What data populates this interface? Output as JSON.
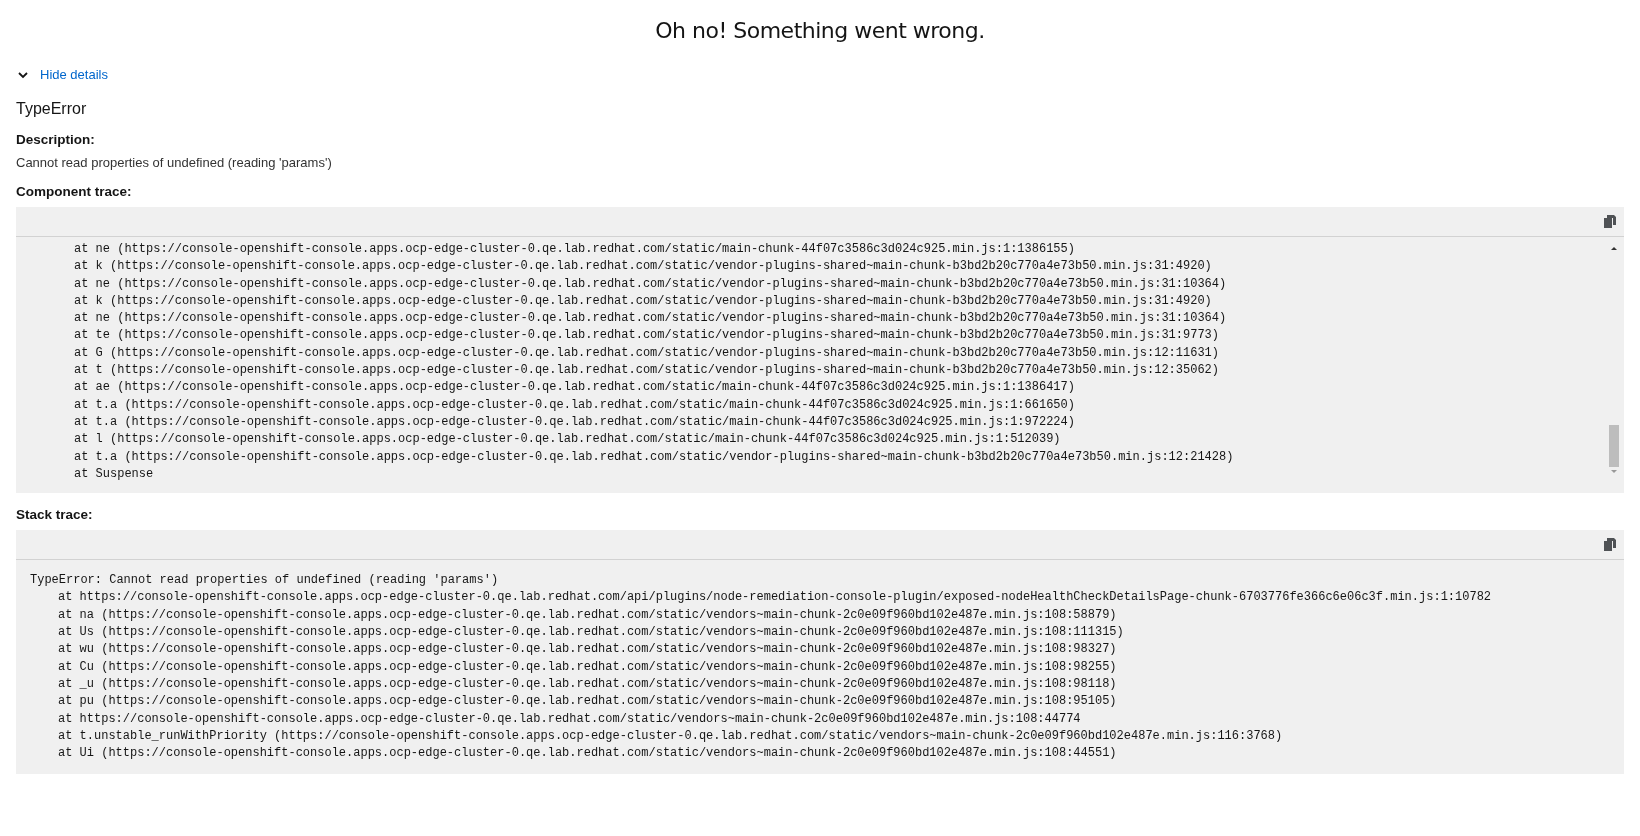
{
  "title": "Oh no! Something went wrong.",
  "details_toggle": {
    "label": "Hide details",
    "expanded": true
  },
  "error_name": "TypeError",
  "description": {
    "label": "Description:",
    "text": "Cannot read properties of undefined (reading 'params')"
  },
  "component_trace": {
    "label": "Component trace:",
    "lines": [
      "at ne (https://console-openshift-console.apps.ocp-edge-cluster-0.qe.lab.redhat.com/static/main-chunk-44f07c3586c3d024c925.min.js:1:1386155)",
      "at k (https://console-openshift-console.apps.ocp-edge-cluster-0.qe.lab.redhat.com/static/vendor-plugins-shared~main-chunk-b3bd2b20c770a4e73b50.min.js:31:4920)",
      "at ne (https://console-openshift-console.apps.ocp-edge-cluster-0.qe.lab.redhat.com/static/vendor-plugins-shared~main-chunk-b3bd2b20c770a4e73b50.min.js:31:10364)",
      "at k (https://console-openshift-console.apps.ocp-edge-cluster-0.qe.lab.redhat.com/static/vendor-plugins-shared~main-chunk-b3bd2b20c770a4e73b50.min.js:31:4920)",
      "at ne (https://console-openshift-console.apps.ocp-edge-cluster-0.qe.lab.redhat.com/static/vendor-plugins-shared~main-chunk-b3bd2b20c770a4e73b50.min.js:31:10364)",
      "at te (https://console-openshift-console.apps.ocp-edge-cluster-0.qe.lab.redhat.com/static/vendor-plugins-shared~main-chunk-b3bd2b20c770a4e73b50.min.js:31:9773)",
      "at G (https://console-openshift-console.apps.ocp-edge-cluster-0.qe.lab.redhat.com/static/vendor-plugins-shared~main-chunk-b3bd2b20c770a4e73b50.min.js:12:11631)",
      "at t (https://console-openshift-console.apps.ocp-edge-cluster-0.qe.lab.redhat.com/static/vendor-plugins-shared~main-chunk-b3bd2b20c770a4e73b50.min.js:12:35062)",
      "at ae (https://console-openshift-console.apps.ocp-edge-cluster-0.qe.lab.redhat.com/static/main-chunk-44f07c3586c3d024c925.min.js:1:1386417)",
      "at t.a (https://console-openshift-console.apps.ocp-edge-cluster-0.qe.lab.redhat.com/static/main-chunk-44f07c3586c3d024c925.min.js:1:661650)",
      "at t.a (https://console-openshift-console.apps.ocp-edge-cluster-0.qe.lab.redhat.com/static/main-chunk-44f07c3586c3d024c925.min.js:1:972224)",
      "at l (https://console-openshift-console.apps.ocp-edge-cluster-0.qe.lab.redhat.com/static/main-chunk-44f07c3586c3d024c925.min.js:1:512039)",
      "at t.a (https://console-openshift-console.apps.ocp-edge-cluster-0.qe.lab.redhat.com/static/vendor-plugins-shared~main-chunk-b3bd2b20c770a4e73b50.min.js:12:21428)",
      "at Suspense"
    ]
  },
  "stack_trace": {
    "label": "Stack trace:",
    "heading": "TypeError: Cannot read properties of undefined (reading 'params')",
    "lines": [
      "at https://console-openshift-console.apps.ocp-edge-cluster-0.qe.lab.redhat.com/api/plugins/node-remediation-console-plugin/exposed-nodeHealthCheckDetailsPage-chunk-6703776fe366c6e06c3f.min.js:1:10782",
      "at na (https://console-openshift-console.apps.ocp-edge-cluster-0.qe.lab.redhat.com/static/vendors~main-chunk-2c0e09f960bd102e487e.min.js:108:58879)",
      "at Us (https://console-openshift-console.apps.ocp-edge-cluster-0.qe.lab.redhat.com/static/vendors~main-chunk-2c0e09f960bd102e487e.min.js:108:111315)",
      "at wu (https://console-openshift-console.apps.ocp-edge-cluster-0.qe.lab.redhat.com/static/vendors~main-chunk-2c0e09f960bd102e487e.min.js:108:98327)",
      "at Cu (https://console-openshift-console.apps.ocp-edge-cluster-0.qe.lab.redhat.com/static/vendors~main-chunk-2c0e09f960bd102e487e.min.js:108:98255)",
      "at _u (https://console-openshift-console.apps.ocp-edge-cluster-0.qe.lab.redhat.com/static/vendors~main-chunk-2c0e09f960bd102e487e.min.js:108:98118)",
      "at pu (https://console-openshift-console.apps.ocp-edge-cluster-0.qe.lab.redhat.com/static/vendors~main-chunk-2c0e09f960bd102e487e.min.js:108:95105)",
      "at https://console-openshift-console.apps.ocp-edge-cluster-0.qe.lab.redhat.com/static/vendors~main-chunk-2c0e09f960bd102e487e.min.js:108:44774",
      "at t.unstable_runWithPriority (https://console-openshift-console.apps.ocp-edge-cluster-0.qe.lab.redhat.com/static/vendors~main-chunk-2c0e09f960bd102e487e.min.js:116:3768)",
      "at Ui (https://console-openshift-console.apps.ocp-edge-cluster-0.qe.lab.redhat.com/static/vendors~main-chunk-2c0e09f960bd102e487e.min.js:108:44551)"
    ]
  }
}
